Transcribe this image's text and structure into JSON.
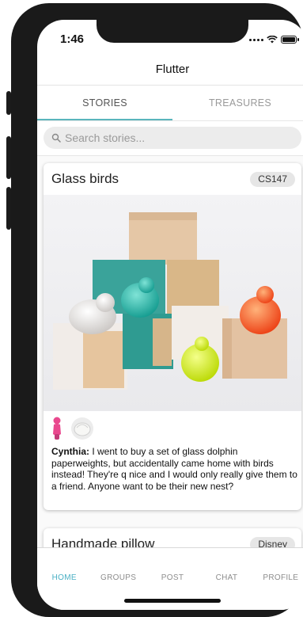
{
  "status_bar": {
    "time": "1:46"
  },
  "app_bar": {
    "title": "Flutter"
  },
  "tabs": [
    {
      "label": "STORIES",
      "active": true
    },
    {
      "label": "TREASURES",
      "active": false
    }
  ],
  "search": {
    "placeholder": "Search stories..."
  },
  "stories": [
    {
      "title": "Glass birds",
      "badge": "CS147",
      "author": "Cynthia:",
      "text": "I went to buy a set of glass dolphin paperweights, but accidentally came home with birds instead! They're q nice and I would only really give them to a friend. Anyone want to be their new nest?"
    },
    {
      "title": "Handmade pillow",
      "badge": "Disney"
    }
  ],
  "bottom_nav": [
    {
      "label": "HOME",
      "active": true
    },
    {
      "label": "GROUPS",
      "active": false
    },
    {
      "label": "POST",
      "active": false
    },
    {
      "label": "CHAT",
      "active": false
    },
    {
      "label": "PROFILE",
      "active": false
    }
  ],
  "colors": {
    "accent": "#5ab5bd",
    "nav_active": "#4ab0c4",
    "badge_bg": "#e6e6e6"
  },
  "icons": [
    "signal-dots-icon",
    "wifi-icon",
    "battery-icon",
    "search-icon"
  ]
}
